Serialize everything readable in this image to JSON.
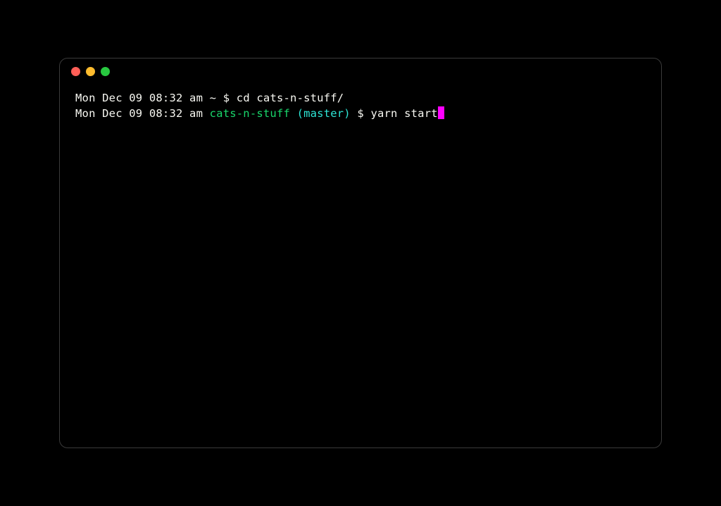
{
  "colors": {
    "close": "#ff5f57",
    "minimize": "#febc2e",
    "maximize": "#28c840",
    "cursor": "#ff00ff",
    "dir": "#19d66b",
    "branch": "#2ee6d6",
    "text": "#f8f8f2"
  },
  "lines": [
    {
      "timestamp": "Mon Dec 09 08:32 am ",
      "tilde": "~ ",
      "prompt": "$ ",
      "command": "cd cats-n-stuff/"
    },
    {
      "timestamp": "Mon Dec 09 08:32 am ",
      "dir": "cats-n-stuff ",
      "branch": "(master) ",
      "prompt": "$ ",
      "command": "yarn start"
    }
  ]
}
